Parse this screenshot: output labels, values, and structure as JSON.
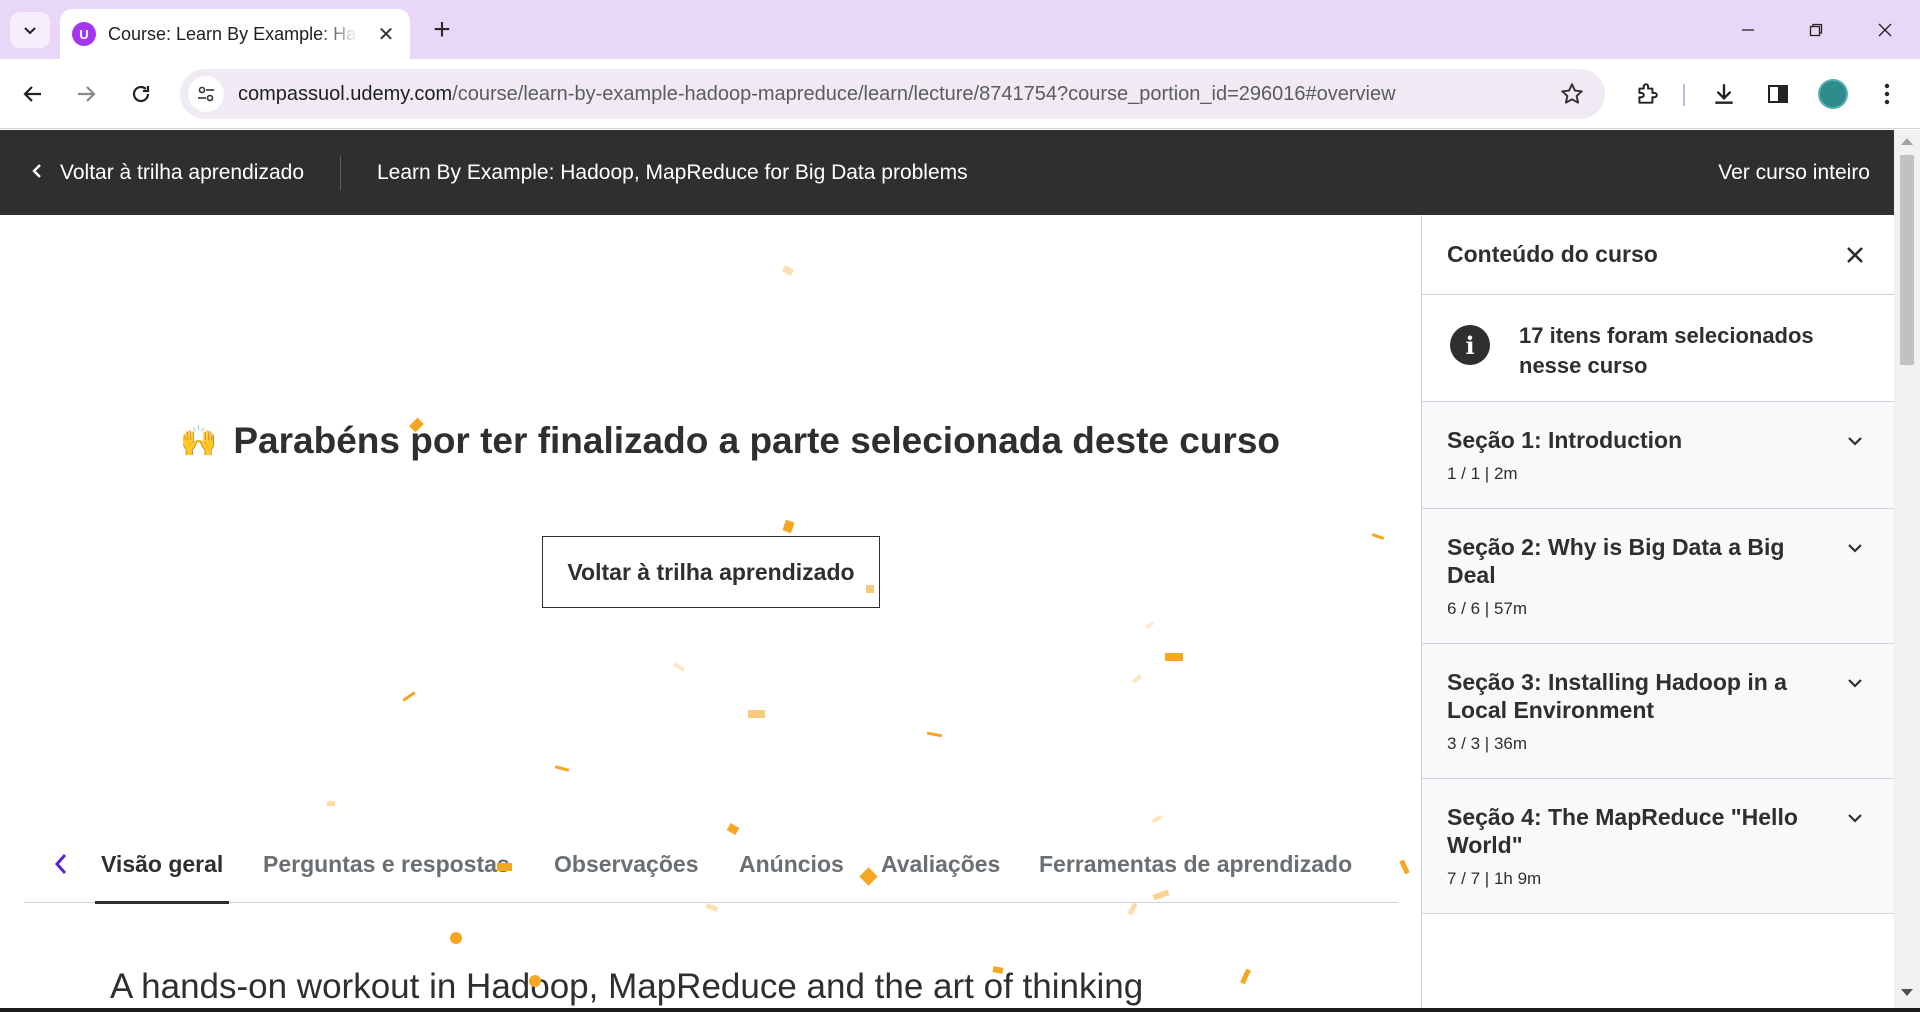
{
  "browser": {
    "tab_title": "Course: Learn By Example: Hadoop, MapReduce for Big Data problems",
    "favicon_letter": "U",
    "url_host": "compassuol.udemy.com",
    "url_path": "/course/learn-by-example-hadoop-mapreduce/learn/lecture/8741754?course_portion_id=296016#overview"
  },
  "header": {
    "back_label": "Voltar à trilha aprendizado",
    "course_title": "Learn By Example: Hadoop, MapReduce for Big Data problems",
    "full_course_label": "Ver curso inteiro"
  },
  "main": {
    "congrats_emoji": "🙌",
    "congrats_text": "Parabéns por ter finalizado a parte selecionada deste curso",
    "return_button": "Voltar à trilha aprendizado",
    "tabs": [
      {
        "label": "Visão geral",
        "active": true
      },
      {
        "label": "Perguntas e respostas"
      },
      {
        "label": "Observações"
      },
      {
        "label": "Anúncios"
      },
      {
        "label": "Avaliações"
      },
      {
        "label": "Ferramentas de aprendizado"
      }
    ],
    "overview_heading": "A hands-on workout in Hadoop, MapReduce and the art of thinking"
  },
  "sidebar": {
    "title": "Conteúdo do curso",
    "info_text": "17 itens foram selecionados nesse curso",
    "sections": [
      {
        "title": "Seção 1: Introduction",
        "meta": "1 / 1 | 2m"
      },
      {
        "title": "Seção 2: Why is Big Data a Big Deal",
        "meta": "6 / 6 | 57m"
      },
      {
        "title": "Seção 3: Installing Hadoop in a Local Environment",
        "meta": "3 / 3 | 36m"
      },
      {
        "title": "Seção 4: The MapReduce \"Hello World\"",
        "meta": "7 / 7 | 1h 9m"
      }
    ]
  },
  "colors": {
    "header_bg": "#2d2f31",
    "tabbar_bg": "#e8d7f7",
    "accent_purple": "#5624d0",
    "confetti": "#f5a623"
  }
}
